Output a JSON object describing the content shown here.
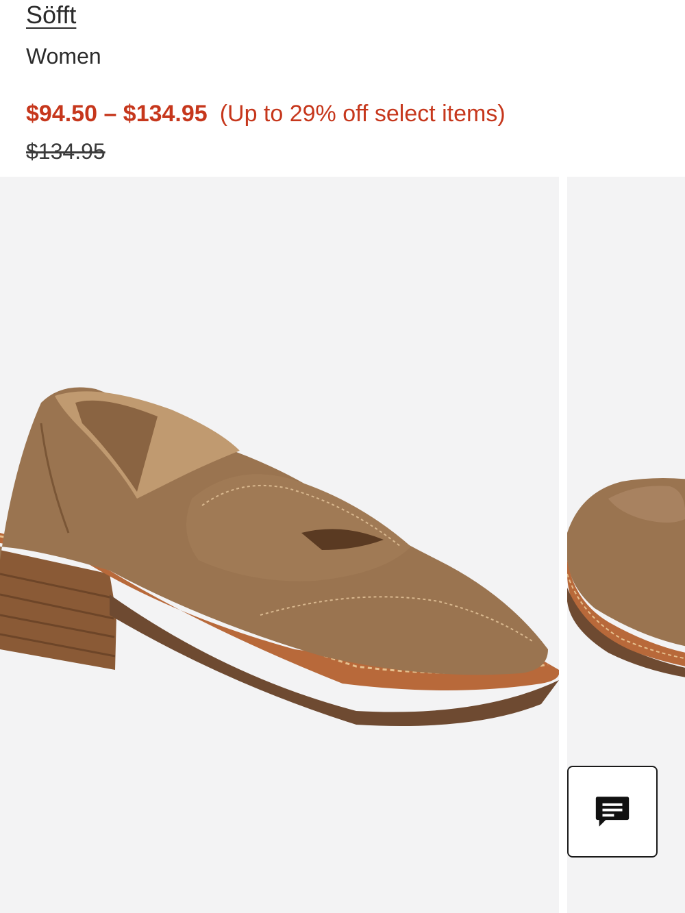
{
  "product": {
    "brand": "Söfft",
    "category": "Women",
    "price_range": "$94.50 – $134.95",
    "discount_note": "(Up to 29% off select items)",
    "original_price": "$134.95"
  },
  "gallery": {
    "image_1": "suede-penny-loafer-main",
    "image_2": "suede-penny-loafer-alternate"
  },
  "chat": {
    "icon": "chat-icon"
  },
  "colors": {
    "sale_red": "#c6371c",
    "suede_brown": "#9a7450",
    "sole_tan": "#b8693a",
    "background_gray": "#f3f3f4"
  }
}
